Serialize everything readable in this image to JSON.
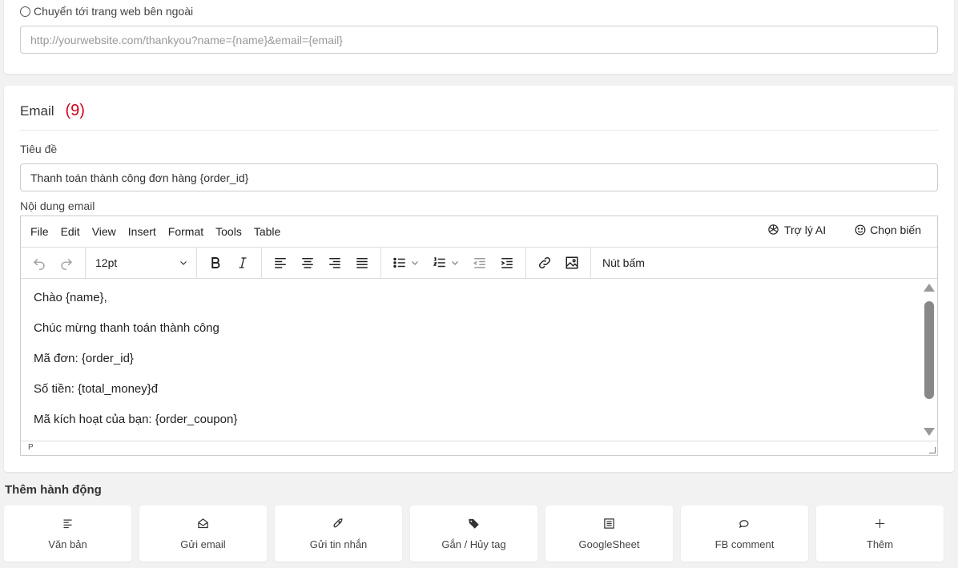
{
  "redirect": {
    "label": "Chuyển tới trang web bên ngoài",
    "url_placeholder": "http://yourwebsite.com/thankyou?name={name}&email={email}"
  },
  "email": {
    "title": "Email",
    "number": "(9)",
    "subject_label": "Tiêu đề",
    "subject_value": "Thanh toán thành công đơn hàng {order_id}",
    "body_label": "Nội dung email",
    "editor": {
      "menu": [
        "File",
        "Edit",
        "View",
        "Insert",
        "Format",
        "Tools",
        "Table"
      ],
      "ai_assistant": "Trợ lý AI",
      "choose_variable": "Chọn biến",
      "font_size": "12pt",
      "button_tool": "Nút bấm",
      "content": [
        "Chào {name},",
        "Chúc mừng thanh toán thành công",
        "Mã đơn: {order_id}",
        "Số tiền: {total_money}đ",
        "Mã kích hoạt của bạn: {order_coupon}"
      ],
      "status_path": "P"
    }
  },
  "add_action": {
    "title": "Thêm hành động",
    "items": [
      {
        "label": "Văn bản",
        "icon": "text-align-icon"
      },
      {
        "label": "Gửi email",
        "icon": "envelope-open-icon"
      },
      {
        "label": "Gửi tin nhắn",
        "icon": "rocket-icon"
      },
      {
        "label": "Gắn / Hủy tag",
        "icon": "tag-icon"
      },
      {
        "label": "GoogleSheet",
        "icon": "sheet-icon"
      },
      {
        "label": "FB comment",
        "icon": "comments-icon"
      },
      {
        "label": "Thêm",
        "icon": "plus-icon"
      }
    ]
  },
  "colors": {
    "accent_red": "#d0021b",
    "page_bg": "#f2f2f2"
  }
}
